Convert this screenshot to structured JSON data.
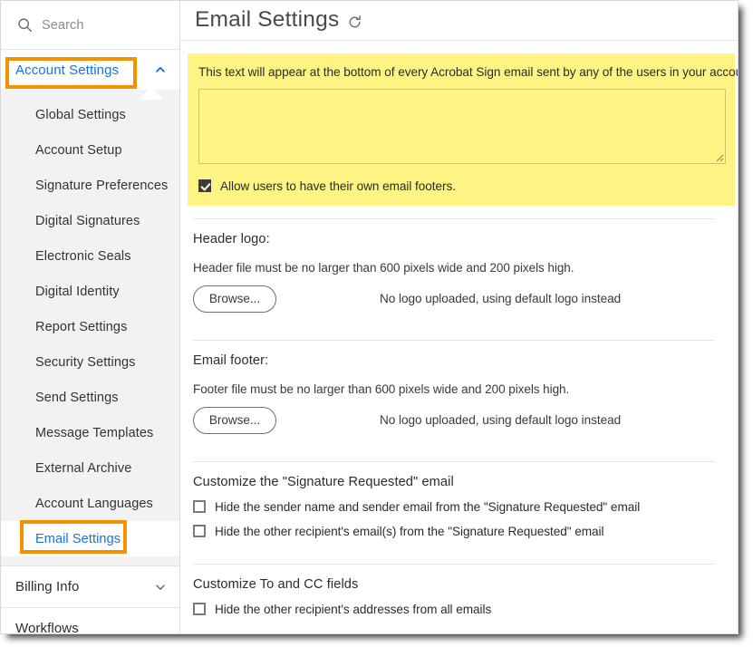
{
  "sidebar": {
    "search": {
      "placeholder": "Search",
      "icon": "search-icon"
    },
    "groups": [
      {
        "label": "Account Settings",
        "state": "expanded",
        "icon": "chevron-up-icon",
        "highlighted": true,
        "items": [
          {
            "label": "Global Settings",
            "selected": false
          },
          {
            "label": "Account Setup",
            "selected": false
          },
          {
            "label": "Signature Preferences",
            "selected": false
          },
          {
            "label": "Digital Signatures",
            "selected": false
          },
          {
            "label": "Electronic Seals",
            "selected": false
          },
          {
            "label": "Digital Identity",
            "selected": false
          },
          {
            "label": "Report Settings",
            "selected": false
          },
          {
            "label": "Security Settings",
            "selected": false
          },
          {
            "label": "Send Settings",
            "selected": false
          },
          {
            "label": "Message Templates",
            "selected": false
          },
          {
            "label": "External Archive",
            "selected": false
          },
          {
            "label": "Account Languages",
            "selected": false
          },
          {
            "label": "Email Settings",
            "selected": true,
            "highlighted": true
          }
        ]
      },
      {
        "label": "Billing Info",
        "state": "collapsed",
        "icon": "chevron-down-icon",
        "highlighted": false,
        "items": []
      },
      {
        "label": "Workflows",
        "state": "none",
        "icon": "",
        "highlighted": false,
        "items": []
      }
    ]
  },
  "header": {
    "title": "Email Settings",
    "refresh_icon": "refresh-icon"
  },
  "email_footer_panel": {
    "description": "This text will appear at the bottom of every Acrobat Sign email sent by any of the users in your account.",
    "textarea_value": "",
    "textarea_placeholder": "",
    "allow_own_footers": {
      "label": "Allow users to have their own email footers.",
      "checked": true
    }
  },
  "header_logo": {
    "title": "Header logo:",
    "note": "Header file must be no larger than 600 pixels wide and 200 pixels high.",
    "browse_label": "Browse...",
    "status": "No logo uploaded, using default logo instead"
  },
  "email_footer_logo": {
    "title": "Email footer:",
    "note": "Footer file must be no larger than 600 pixels wide and 200 pixels high.",
    "browse_label": "Browse...",
    "status": "No logo uploaded, using default logo instead"
  },
  "signature_requested": {
    "title": "Customize the \"Signature Requested\" email",
    "options": [
      {
        "label": "Hide the sender name and sender email from the \"Signature Requested\" email",
        "checked": false
      },
      {
        "label": "Hide the other recipient's email(s) from the \"Signature Requested\" email",
        "checked": false
      }
    ]
  },
  "to_cc_fields": {
    "title": "Customize To and CC fields",
    "options": [
      {
        "label": "Hide the other recipient's addresses from all emails",
        "checked": false
      }
    ]
  },
  "colors": {
    "highlight_orange": "#f59000",
    "link_blue": "#1473e6",
    "banner_yellow": "#fdf484",
    "submenu_gray": "#f2f2f2"
  }
}
